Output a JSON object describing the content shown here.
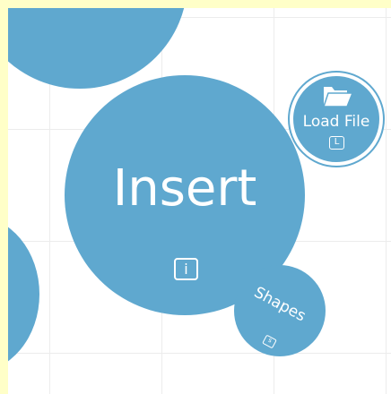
{
  "menu": {
    "insert": {
      "label": "Insert",
      "shortcut": "i"
    },
    "shapes": {
      "label": "Shapes",
      "shortcut": "s"
    },
    "load_file": {
      "label": "Load File",
      "shortcut": "L",
      "icon": "folder-open-icon"
    }
  },
  "colors": {
    "bubble": "#5fa8cf",
    "background": "#ffffc8",
    "canvas": "#ffffff",
    "grid": "#ececec"
  }
}
